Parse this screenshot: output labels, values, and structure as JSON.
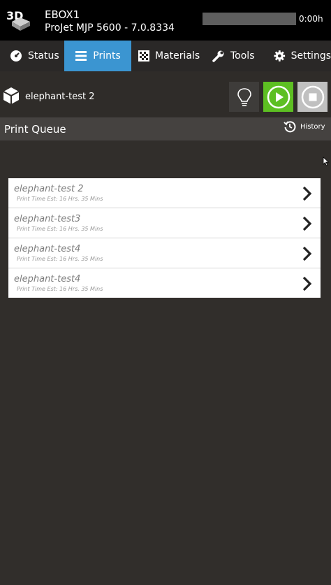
{
  "header": {
    "logo": "3d-systems-logo",
    "device_name": "EBOX1",
    "device_model": "ProJet MJP 5600 - 7.0.8334",
    "progress_percent": 0,
    "time": "0:00h"
  },
  "tabs": [
    {
      "label": "Status",
      "icon": "gauge-icon",
      "active": false
    },
    {
      "label": "Prints",
      "icon": "list-icon",
      "active": true
    },
    {
      "label": "Materials",
      "icon": "checker-icon",
      "active": false
    },
    {
      "label": "Tools",
      "icon": "wrench-icon",
      "active": false
    },
    {
      "label": "Settings",
      "icon": "gear-icon",
      "active": false
    }
  ],
  "current_job": {
    "icon": "cube-icon",
    "name": "elephant-test 2"
  },
  "controls": {
    "bulb": "lightbulb-icon",
    "play": "play-icon",
    "stop": "stop-icon",
    "play_color": "#5dbf22"
  },
  "queue": {
    "title": "Print Queue",
    "history_label": "History",
    "items": [
      {
        "name": "elephant-test 2",
        "sub": "Print Time Est: 16 Hrs. 35 Mins"
      },
      {
        "name": "elephant-test3",
        "sub": "Print Time Est: 16 Hrs. 35 Mins"
      },
      {
        "name": "elephant-test4",
        "sub": "Print Time Est: 16 Hrs. 35 Mins"
      },
      {
        "name": "elephant-test4",
        "sub": "Print Time Est: 16 Hrs. 35 Mins"
      }
    ]
  },
  "colors": {
    "accent": "#3b95d1",
    "background": "#312e2b",
    "topbar": "#000000"
  }
}
